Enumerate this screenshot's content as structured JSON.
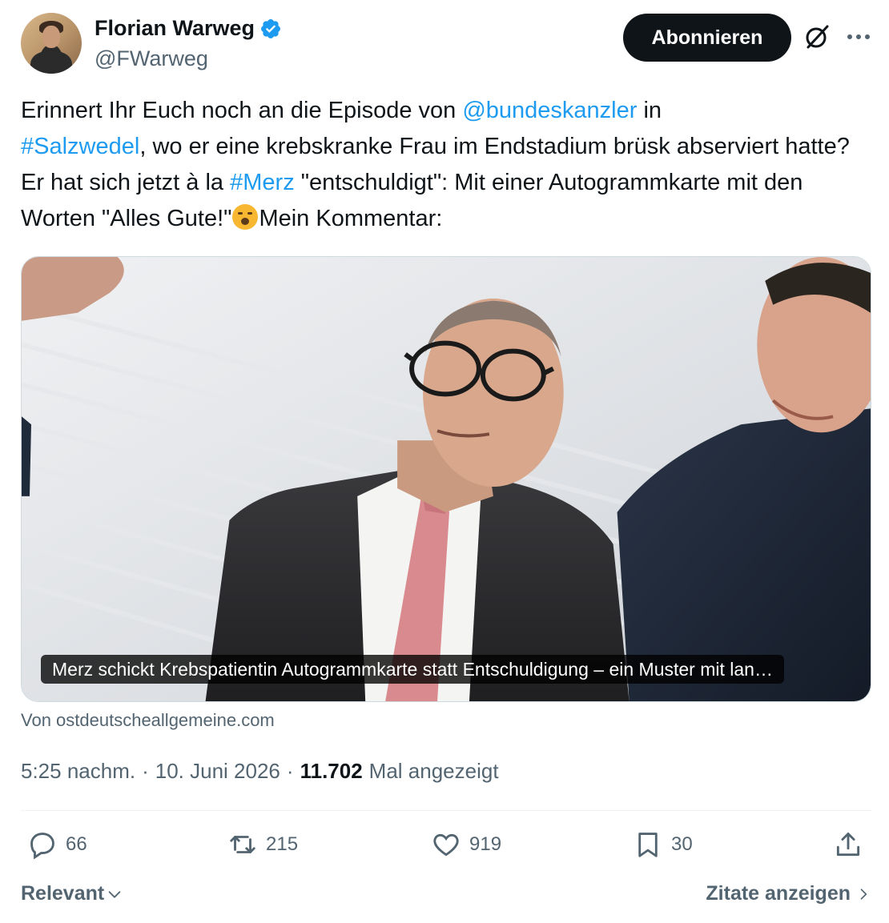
{
  "author": {
    "display_name": "Florian Warweg",
    "handle": "@FWarweg"
  },
  "header": {
    "follow_label": "Abonnieren"
  },
  "tweet": {
    "segments": [
      {
        "text": "Erinnert Ihr Euch noch an die Episode von ",
        "type": "text"
      },
      {
        "text": "@bundeskanzler",
        "type": "mention"
      },
      {
        "text": " in ",
        "type": "text"
      },
      {
        "text": "#Salzwedel",
        "type": "hashtag"
      },
      {
        "text": ", wo er eine krebskranke Frau im Endstadium brüsk abserviert hatte? Er hat sich jetzt à la ",
        "type": "text"
      },
      {
        "text": "#Merz",
        "type": "hashtag"
      },
      {
        "text": " \"entschuldigt\": Mit einer Autogrammkarte mit den Worten \"Alles Gute!\"",
        "type": "text"
      },
      {
        "text": "Mein Kommentar:",
        "type": "text"
      }
    ]
  },
  "card": {
    "caption": "Merz schickt Krebspatientin Autogrammkarte statt Entschuldigung – ein Muster mit lan…",
    "source": "Von ostdeutscheallgemeine.com"
  },
  "meta": {
    "time": "5:25 nachm.",
    "sep1": "·",
    "date": "10. Juni 2026",
    "sep2": "·",
    "views_count": "11.702",
    "views_label": "Mal angezeigt"
  },
  "actions": {
    "replies": "66",
    "reposts": "215",
    "likes": "919",
    "bookmarks": "30"
  },
  "footer": {
    "sort_label": "Relevant",
    "quotes_label": "Zitate anzeigen"
  },
  "colors": {
    "link": "#1d9bf0",
    "text": "#0f1419",
    "muted": "#536471",
    "button_bg": "#0f1419"
  }
}
